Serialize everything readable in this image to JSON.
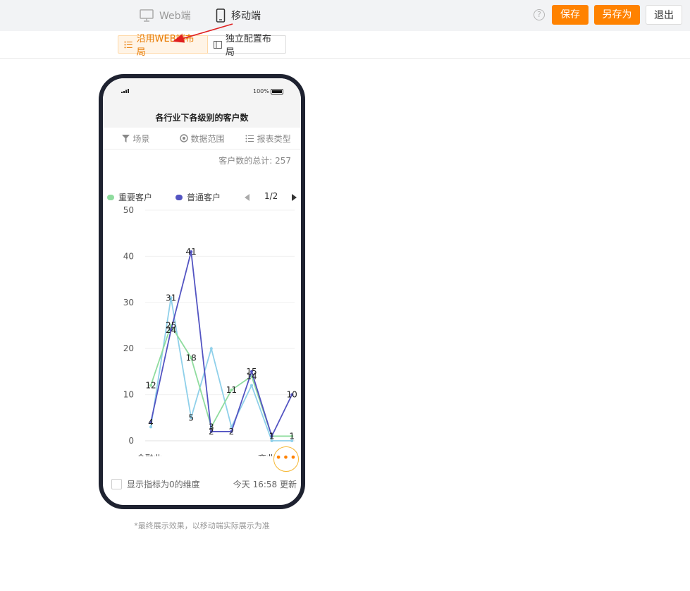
{
  "topbar": {
    "modes": [
      {
        "label": "Web端",
        "active": false
      },
      {
        "label": "移动端",
        "active": true
      }
    ],
    "help_icon": "question-circle-icon",
    "buttons": {
      "save": "保存",
      "save_as": "另存为",
      "exit": "退出"
    }
  },
  "layout_toggle": {
    "use_web_layout": "沿用WEB端布局",
    "independent_layout": "独立配置布局",
    "selected": "沿用WEB端布局"
  },
  "phone": {
    "battery": "100%",
    "title": "各行业下各级别的客户数",
    "filters": [
      {
        "label": "场景",
        "icon": "filter-icon"
      },
      {
        "label": "数据范围",
        "icon": "scope-icon"
      },
      {
        "label": "报表类型",
        "icon": "list-icon"
      }
    ],
    "total_label": "客户数的总计:",
    "total_value": "257",
    "legend_page": "1/2",
    "checkbox_label": "显示指标为0的维度",
    "updated": "今天 16:58 更新",
    "more_icon": "ellipsis-icon"
  },
  "chart_data": {
    "type": "line",
    "ylim": [
      0,
      50
    ],
    "yticks": [
      0,
      10,
      20,
      30,
      40,
      50
    ],
    "x_labels_visible": [
      "金融业",
      "商业服"
    ],
    "x": [
      1,
      2,
      3,
      4,
      5,
      6,
      7,
      8
    ],
    "series": [
      {
        "name": "重要客户",
        "color": "#8fdc9e",
        "values": [
          12,
          25,
          18,
          3,
          11,
          14,
          1,
          1
        ],
        "labels": true
      },
      {
        "name": "普通客户",
        "color": "#5354c2",
        "values": [
          4,
          24,
          41,
          2,
          2,
          15,
          1,
          10
        ],
        "labels": true
      },
      {
        "name": "",
        "color": "#8fd0ea",
        "values": [
          3,
          31,
          5,
          20,
          3,
          12,
          0,
          0
        ],
        "labels": false
      }
    ],
    "extra_point_labels": [
      {
        "x": 2,
        "text": "31"
      },
      {
        "x": 3,
        "text": "5"
      }
    ]
  },
  "note": "*最终展示效果，以移动端实际展示为准",
  "colors": {
    "accent": "#ff8200",
    "phone_frame": "#1e2230",
    "arrow": "#e02020"
  }
}
